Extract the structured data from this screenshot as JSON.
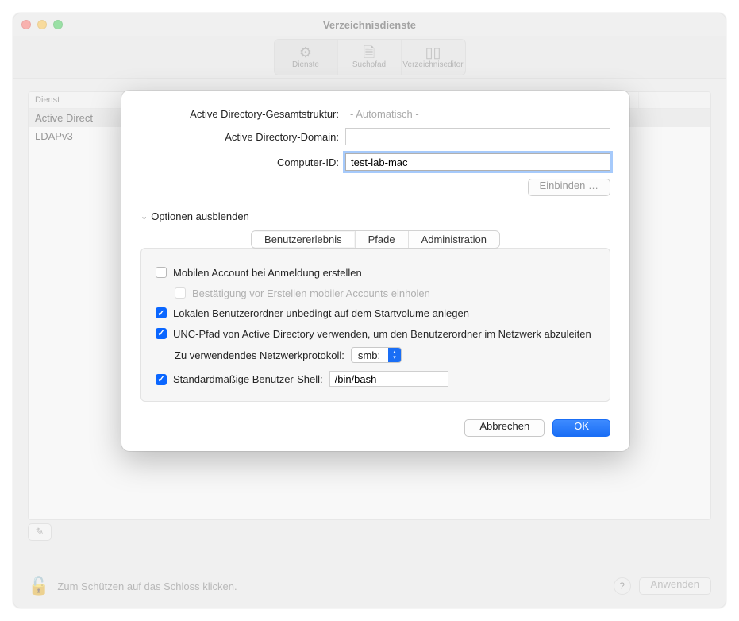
{
  "window": {
    "title": "Verzeichnisdienste"
  },
  "toolbar": {
    "items": [
      {
        "label": "Dienste"
      },
      {
        "label": "Suchpfad"
      },
      {
        "label": "Verzeichniseditor"
      }
    ]
  },
  "table": {
    "header_name": "Dienst",
    "rows": [
      {
        "name": "Active Direct"
      },
      {
        "name": "LDAPv3"
      }
    ]
  },
  "footer": {
    "lock_hint": "Zum Schützen auf das Schloss klicken.",
    "apply": "Anwenden"
  },
  "dialog": {
    "forest_label": "Active Directory-Gesamtstruktur:",
    "forest_value": "- Automatisch -",
    "domain_label": "Active Directory-Domain:",
    "domain_value": "",
    "computer_label": "Computer-ID:",
    "computer_value": "test-lab-mac",
    "bind_button": "Einbinden …",
    "disclosure": "Optionen ausblenden",
    "tabs": [
      {
        "label": "Benutzererlebnis"
      },
      {
        "label": "Pfade"
      },
      {
        "label": "Administration"
      }
    ],
    "options": {
      "mobile_account": {
        "checked": false,
        "label": "Mobilen Account bei Anmeldung erstellen"
      },
      "confirm_mobile": {
        "checked": false,
        "label": "Bestätigung vor Erstellen mobiler Accounts einholen"
      },
      "local_home": {
        "checked": true,
        "label": "Lokalen Benutzerordner unbedingt auf dem Startvolume anlegen"
      },
      "unc_path": {
        "checked": true,
        "label": "UNC-Pfad von Active Directory verwenden, um den Benutzerordner im Netzwerk abzuleiten"
      },
      "protocol_label": "Zu verwendendes Netzwerkprotokoll:",
      "protocol_value": "smb:",
      "shell": {
        "checked": true,
        "label": "Standardmäßige Benutzer-Shell:",
        "value": "/bin/bash"
      }
    },
    "buttons": {
      "cancel": "Abbrechen",
      "ok": "OK"
    }
  }
}
